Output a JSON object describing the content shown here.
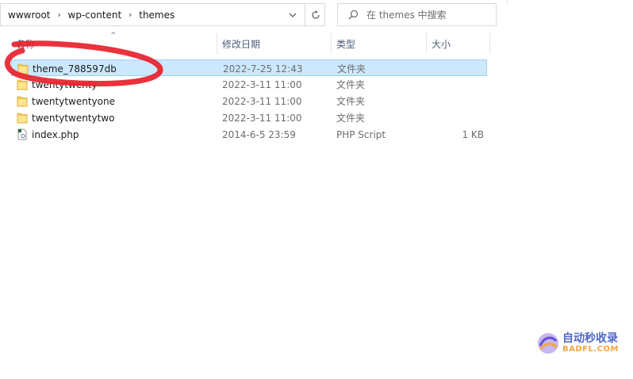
{
  "address_bar": {
    "breadcrumbs": [
      "wwwroot",
      "wp-content",
      "themes"
    ]
  },
  "search": {
    "placeholder": "在 themes 中搜索"
  },
  "columns": {
    "name": "名称",
    "date": "修改日期",
    "type": "类型",
    "size": "大小"
  },
  "files": [
    {
      "name": "theme_788597db",
      "date": "2022-7-25 12:43",
      "type": "文件夹",
      "size": "",
      "icon": "folder-icon",
      "selected": true
    },
    {
      "name": "twentytwenty",
      "date": "2022-3-11 11:00",
      "type": "文件夹",
      "size": "",
      "icon": "folder-icon",
      "selected": false
    },
    {
      "name": "twentytwentyone",
      "date": "2022-3-11 11:00",
      "type": "文件夹",
      "size": "",
      "icon": "folder-icon",
      "selected": false
    },
    {
      "name": "twentytwentytwo",
      "date": "2022-3-11 11:00",
      "type": "文件夹",
      "size": "",
      "icon": "folder-icon",
      "selected": false
    },
    {
      "name": "index.php",
      "date": "2014-6-5 23:59",
      "type": "PHP Script",
      "size": "1 KB",
      "icon": "php-file-icon",
      "selected": false
    }
  ],
  "watermark": {
    "cn": "自动秒收录",
    "en": "BADFL.COM"
  },
  "colors": {
    "selection": "#cce8ff",
    "annotation": "#e8212b",
    "folder": "#ffd766"
  }
}
